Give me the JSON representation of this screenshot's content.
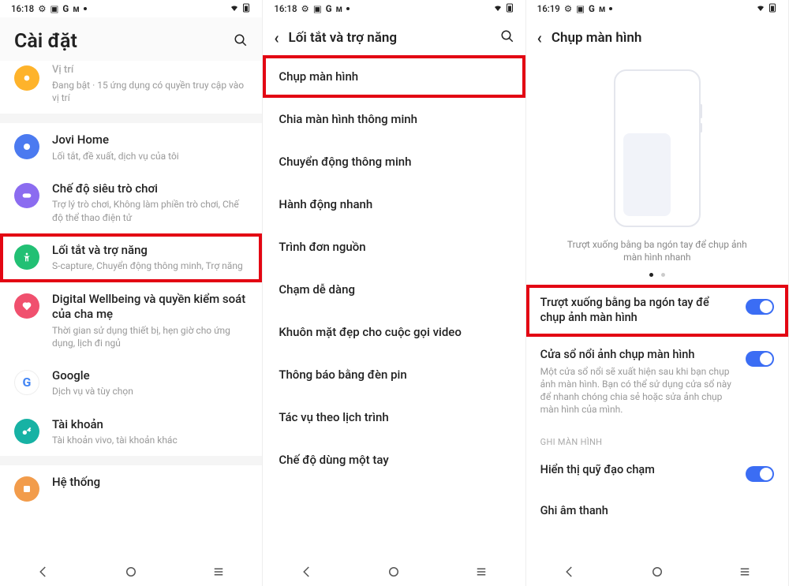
{
  "statusbar": {
    "time1": "16:18",
    "time2": "16:18",
    "time3": "16:19"
  },
  "s1": {
    "title": "Cài đặt",
    "items": [
      {
        "title": "Vị trí",
        "sub": "Đang bật · 15 ứng dụng có quyền truy cập vào vị trí",
        "color": "yellow"
      },
      {
        "title": "Jovi Home",
        "sub": "Lối tắt, đề xuất, dịch vụ của tôi",
        "color": "blue"
      },
      {
        "title": "Chế độ siêu trò chơi",
        "sub": "Trợ lý trò chơi, Không làm phiền trò chơi, Chế độ thể thao điện tử",
        "color": "purple"
      },
      {
        "title": "Lối tắt và trợ năng",
        "sub": "S-capture, Chuyển động thông minh, Trợ năng",
        "color": "green"
      },
      {
        "title": "Digital Wellbeing và quyền kiểm soát của cha mẹ",
        "sub": "Thời gian sử dụng thiết bị, hẹn giờ cho ứng dụng, lịch đi ngủ",
        "color": "red"
      },
      {
        "title": "Google",
        "sub": "Dịch vụ và tùy chọn",
        "color": ""
      },
      {
        "title": "Tài khoản",
        "sub": "Tài khoản vivo, tài khoản khác",
        "color": "teal"
      },
      {
        "title": "Hệ thống",
        "sub": "",
        "color": "orange"
      }
    ]
  },
  "s2": {
    "title": "Lối tắt và trợ năng",
    "items": [
      "Chụp màn hình",
      "Chia màn hình thông minh",
      "Chuyển động thông minh",
      "Hành động nhanh",
      "Trình đơn nguồn",
      "Chạm dễ dàng",
      "Khuôn mặt đẹp cho cuộc gọi video",
      "Thông báo bằng đèn pin",
      "Tác vụ theo lịch trình",
      "Chế độ dùng một tay"
    ]
  },
  "s3": {
    "title": "Chụp màn hình",
    "caption": "Trượt xuống bằng ba ngón tay để chụp ảnh màn hình nhanh",
    "rows": [
      {
        "title": "Trượt xuống bằng ba ngón tay để chụp ảnh màn hình",
        "sub": ""
      },
      {
        "title": "Cửa sổ nổi ảnh chụp màn hình",
        "sub": "Một cửa sổ nổi sẽ xuất hiện sau khi bạn chụp ảnh màn hình. Bạn có thể sử dụng cửa sổ này để nhanh chóng chia sẻ hoặc sửa ảnh chụp màn hình của mình."
      }
    ],
    "section": "GHI MÀN HÌNH",
    "rows2": [
      {
        "title": "Hiển thị quỹ đạo chạm"
      },
      {
        "title": "Ghi âm thanh"
      }
    ]
  }
}
